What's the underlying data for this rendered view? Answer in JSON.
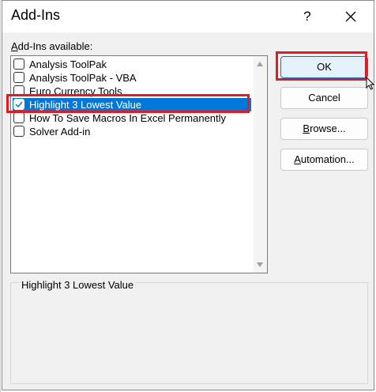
{
  "dialog": {
    "title": "Add-Ins",
    "help_label": "?"
  },
  "addins": {
    "label_underlined": "A",
    "label_rest": "dd-Ins available:",
    "items": [
      {
        "label": "Analysis ToolPak",
        "checked": false,
        "selected": false
      },
      {
        "label": "Analysis ToolPak - VBA",
        "checked": false,
        "selected": false
      },
      {
        "label": "Euro Currency Tools",
        "checked": false,
        "selected": false
      },
      {
        "label": "Highlight 3 Lowest Value",
        "checked": true,
        "selected": true
      },
      {
        "label": "How To Save Macros In Excel Permanently",
        "checked": false,
        "selected": false
      },
      {
        "label": "Solver Add-in",
        "checked": false,
        "selected": false
      }
    ]
  },
  "buttons": {
    "ok": "OK",
    "cancel": "Cancel",
    "browse_underlined": "B",
    "browse_rest": "rowse...",
    "automation_underlined": "A",
    "automation_rest": "utomation..."
  },
  "description": {
    "text": "Highlight 3 Lowest Value"
  },
  "colors": {
    "selection": "#0078d7",
    "annotation": "#e01b24"
  }
}
